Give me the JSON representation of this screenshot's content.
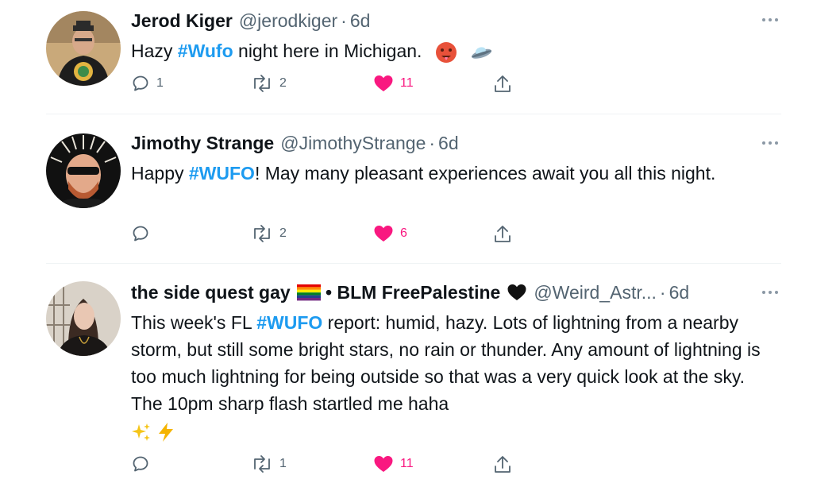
{
  "tweets": [
    {
      "name": "Jerod Kiger",
      "handle": "@jerodkiger",
      "time": "6d",
      "text_before": "Hazy ",
      "hashtag": "#Wufo",
      "text_after": " night here in Michigan.",
      "emojis": [
        "hot-face-emoji",
        "flying-saucer-emoji"
      ],
      "replies": "1",
      "retweets": "2",
      "likes": "11"
    },
    {
      "name": "Jimothy Strange",
      "handle": "@JimothyStrange",
      "time": "6d",
      "text_before": "Happy ",
      "hashtag": "#WUFO",
      "text_after": "! May many pleasant experiences await you all this night.",
      "replies": "",
      "retweets": "2",
      "likes": "6"
    },
    {
      "name_part1": "the side quest gay",
      "name_sep": " • ",
      "name_part2": "BLM FreePalestine",
      "handle": "@Weird_Astr...",
      "time": "6d",
      "text_before": "This week's FL ",
      "hashtag": "#WUFO",
      "text_after": " report: humid, hazy. Lots of lightning from a nearby storm, but still some bright stars, no rain or thunder. Any amount of lightning is too much lightning for being outside so that was a very quick look at the sky. The 10pm sharp flash startled me haha",
      "emojis": [
        "sparkles-emoji",
        "lightning-emoji"
      ],
      "replies": "",
      "retweets": "1",
      "likes": "11"
    }
  ],
  "separator_dot": "·",
  "colors": {
    "hashtag": "#1d9bf0",
    "like": "#f91880",
    "muted": "#536471"
  }
}
